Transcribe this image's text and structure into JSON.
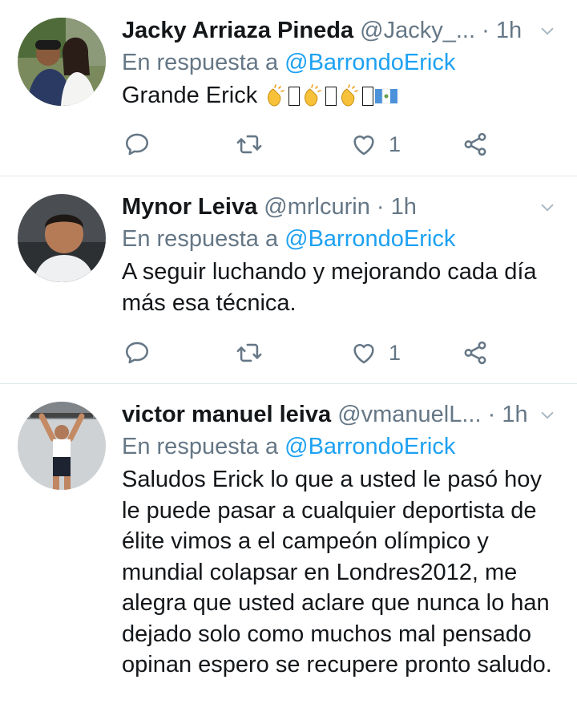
{
  "tweets": [
    {
      "name": "Jacky Arriaza Pineda",
      "handle": "@Jacky_...",
      "time": "1h",
      "reply_prefix": "En respuesta a",
      "reply_to": "@BarrondoErick",
      "text": "Grande Erick",
      "likes": "1"
    },
    {
      "name": "Mynor Leiva",
      "handle": "@mrlcurin",
      "time": "1h",
      "reply_prefix": "En respuesta a",
      "reply_to": "@BarrondoErick",
      "text": "A seguir luchando y mejorando cada día más esa técnica.",
      "likes": "1"
    },
    {
      "name": "victor manuel leiva",
      "handle": "@vmanuelL...",
      "time": "1h",
      "reply_prefix": "En respuesta a",
      "reply_to": "@BarrondoErick",
      "text": "Saludos Erick lo que a usted le pasó hoy le puede pasar a cualquier deportista de élite vimos a el campeón olímpico y mundial colapsar en Londres2012, me alegra que usted aclare que nunca lo han dejado solo como muchos mal pensado opinan espero se recupere pronto saludo."
    }
  ],
  "separator": "·",
  "icons": {
    "reply": "reply-icon",
    "retweet": "retweet-icon",
    "like": "heart-icon",
    "share": "share-icon",
    "more": "chevron-down-icon"
  },
  "colors": {
    "link": "#1da1f2",
    "muted": "#657786",
    "text": "#14171a",
    "divider": "#e1e8ed"
  }
}
